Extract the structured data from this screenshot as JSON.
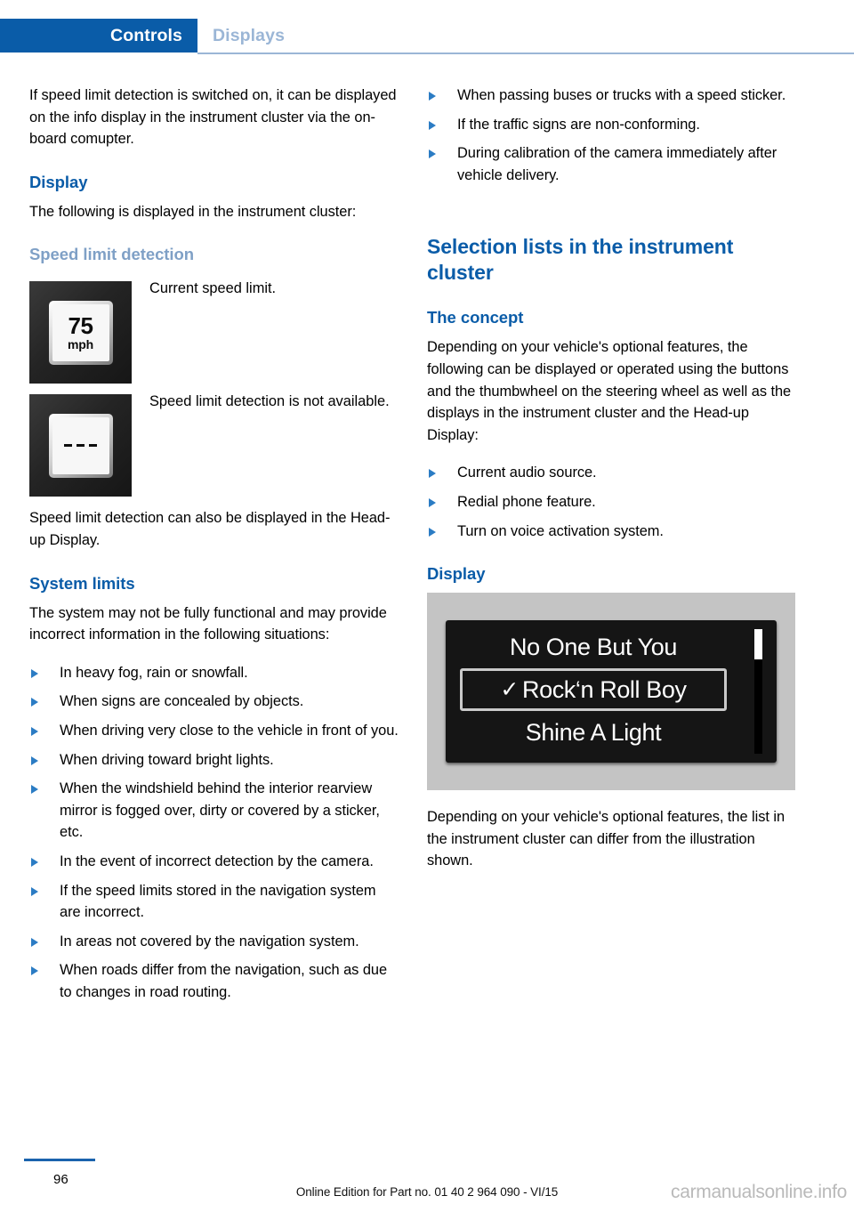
{
  "header": {
    "active_tab": "Controls",
    "inactive_tab": "Displays",
    "accent_color": "#0a5ca8",
    "inactive_color": "#9bb6d6"
  },
  "left_column": {
    "intro_paragraph": "If speed limit detection is switched on, it can be displayed on the info display in the instrument cluster via the on-board comupter.",
    "display_heading": "Display",
    "display_paragraph": "The following is displayed in the instrument cluster:",
    "speed_limit_detection_heading": "Speed limit detection",
    "figures": [
      {
        "icon": "speed-limit-sign-icon",
        "sign_value": "75",
        "sign_unit": "mph",
        "caption": "Current speed limit."
      },
      {
        "icon": "speed-limit-unavailable-icon",
        "sign_value": "- - -",
        "sign_unit": "",
        "caption": "Speed limit detection is not available."
      }
    ],
    "hud_paragraph": "Speed limit detection can also be displayed in the Head-up Display.",
    "system_limits_heading": "System limits",
    "system_limits_paragraph": "The system may not be fully functional and may provide incorrect information in the following situations:",
    "system_limits_bullets": [
      "In heavy fog, rain or snowfall.",
      "When signs are concealed by objects.",
      "When driving very close to the vehicle in front of you.",
      "When driving toward bright lights.",
      "When the windshield behind the interior rearview mirror is fogged over, dirty or covered by a sticker, etc.",
      "In the event of incorrect detection by the camera.",
      "If the speed limits stored in the navigation system are incorrect.",
      "In areas not covered by the navigation system.",
      "When roads differ from the navigation, such as due to changes in road routing."
    ]
  },
  "right_column": {
    "continued_bullets": [
      "When passing buses or trucks with a speed sticker.",
      "If the traffic signs are non-conforming.",
      "During calibration of the camera immediately after vehicle delivery."
    ],
    "section_heading": "Selection lists in the instrument cluster",
    "concept_heading": "The concept",
    "concept_paragraph": "Depending on your vehicle's optional features, the following can be displayed or operated using the buttons and the thumbwheel on the steering wheel as well as the displays in the instrument cluster and the Head-up Display:",
    "concept_bullets": [
      "Current audio source.",
      "Redial phone feature.",
      "Turn on voice activation system."
    ],
    "display_heading": "Display",
    "cluster_display": {
      "items": [
        {
          "label": "No One But You",
          "selected": false,
          "check": ""
        },
        {
          "label": "Rock‘n Roll Boy",
          "selected": true,
          "check": "✓"
        },
        {
          "label": "Shine A Light",
          "selected": false,
          "check": ""
        }
      ]
    },
    "closing_paragraph": "Depending on your vehicle's optional features, the list in the instrument cluster can differ from the illustration shown."
  },
  "footer": {
    "page_number": "96",
    "edition_note": "Online Edition for Part no. 01 40 2 964 090 - VI/15",
    "watermark": "carmanualsonline.info"
  }
}
